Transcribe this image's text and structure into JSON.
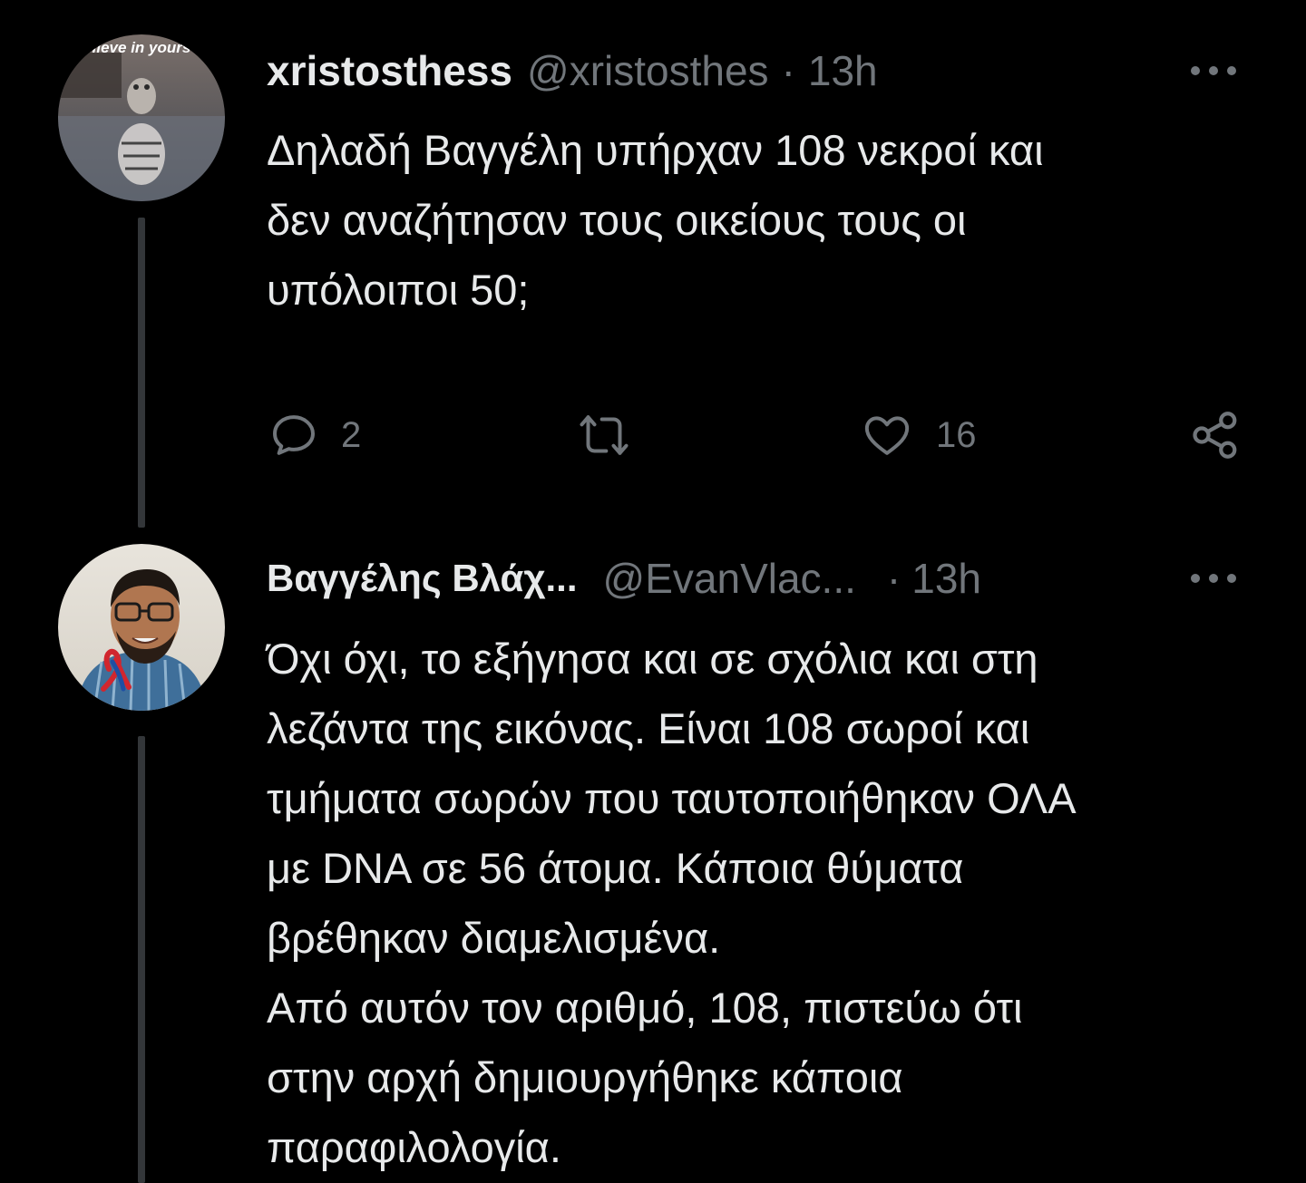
{
  "colors": {
    "background": "#000000",
    "primary_text": "#e7e9ea",
    "secondary_text": "#71767b",
    "thread_line": "#333639"
  },
  "tweets": [
    {
      "display_name": "xristosthess",
      "handle": "@xristosthes",
      "separator": "·",
      "time": "13h",
      "avatar_text": "lieve in yours",
      "avatar_icon": "kitten-tiger-reflection-avatar",
      "body_lines": [
        "Δηλαδή Βαγγέλη υπήρχαν 108 νεκροί και",
        "δεν αναζήτησαν τους οικείους τους οι",
        "υπόλοιποι 50;"
      ],
      "actions": {
        "reply": {
          "icon": "reply-icon",
          "count": "2"
        },
        "retweet": {
          "icon": "retweet-icon",
          "count": ""
        },
        "like": {
          "icon": "heart-icon",
          "count": "16"
        },
        "share": {
          "icon": "share-icon"
        }
      },
      "more_icon": "more-icon"
    },
    {
      "display_name": "Βαγγέλης Βλάχ...",
      "handle": "@EvanVlac...",
      "separator": "·",
      "time": "13h",
      "avatar_icon": "man-with-awareness-ribbon-avatar",
      "body_lines": [
        "Όχι όχι, το εξήγησα και σε σχόλια και στη",
        "λεζάντα της εικόνας. Είναι 108 σωροί και",
        "τμήματα σωρών που ταυτοποιήθηκαν ΟΛΑ",
        "με DNA σε 56 άτομα. Κάποια θύματα",
        "βρέθηκαν διαμελισμένα.",
        "Από αυτόν τον αριθμό, 108, πιστεύω ότι",
        "στην αρχή δημιουργήθηκε κάποια",
        "παραφιλολογία."
      ],
      "more_icon": "more-icon"
    }
  ]
}
